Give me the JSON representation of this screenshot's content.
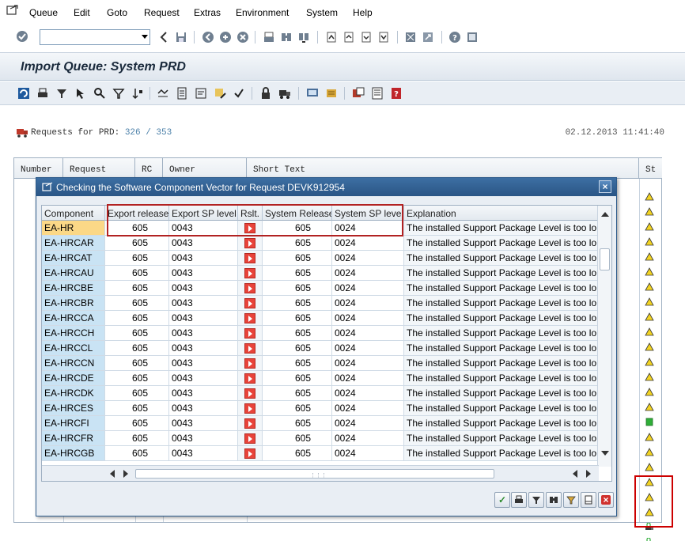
{
  "menubar": {
    "items": [
      {
        "label": "Queue"
      },
      {
        "label": "Edit"
      },
      {
        "label": "Goto"
      },
      {
        "label": "Request"
      },
      {
        "label": "Extras"
      },
      {
        "label": "Environment"
      },
      {
        "label": "System"
      },
      {
        "label": "Help"
      }
    ]
  },
  "system_toolbar": {
    "command_field_value": ""
  },
  "screen": {
    "title": "Import Queue: System PRD",
    "requests_label": "Requests for PRD:",
    "requests_count": "326 / 353",
    "date": "02.12.2013",
    "time": "11:41:40"
  },
  "background_table": {
    "columns": [
      "Number",
      "Request",
      "RC",
      "Owner",
      "Short Text",
      "St"
    ]
  },
  "dialog": {
    "title": "Checking the Software Component Vector for Request DEVK912954",
    "columns": [
      "Component",
      "Export release",
      "Export SP level",
      "Rslt.",
      "System Release",
      "System SP level",
      "Explanation"
    ],
    "rows": [
      {
        "component": "EA-HR",
        "export_release": "605",
        "export_sp": "0043",
        "system_release": "605",
        "system_sp": "0024",
        "explanation": "The installed Support Package Level is too lo"
      },
      {
        "component": "EA-HRCAR",
        "export_release": "605",
        "export_sp": "0043",
        "system_release": "605",
        "system_sp": "0024",
        "explanation": "The installed Support Package Level is too lo"
      },
      {
        "component": "EA-HRCAT",
        "export_release": "605",
        "export_sp": "0043",
        "system_release": "605",
        "system_sp": "0024",
        "explanation": "The installed Support Package Level is too lo"
      },
      {
        "component": "EA-HRCAU",
        "export_release": "605",
        "export_sp": "0043",
        "system_release": "605",
        "system_sp": "0024",
        "explanation": "The installed Support Package Level is too lo"
      },
      {
        "component": "EA-HRCBE",
        "export_release": "605",
        "export_sp": "0043",
        "system_release": "605",
        "system_sp": "0024",
        "explanation": "The installed Support Package Level is too lo"
      },
      {
        "component": "EA-HRCBR",
        "export_release": "605",
        "export_sp": "0043",
        "system_release": "605",
        "system_sp": "0024",
        "explanation": "The installed Support Package Level is too lo"
      },
      {
        "component": "EA-HRCCA",
        "export_release": "605",
        "export_sp": "0043",
        "system_release": "605",
        "system_sp": "0024",
        "explanation": "The installed Support Package Level is too lo"
      },
      {
        "component": "EA-HRCCH",
        "export_release": "605",
        "export_sp": "0043",
        "system_release": "605",
        "system_sp": "0024",
        "explanation": "The installed Support Package Level is too lo"
      },
      {
        "component": "EA-HRCCL",
        "export_release": "605",
        "export_sp": "0043",
        "system_release": "605",
        "system_sp": "0024",
        "explanation": "The installed Support Package Level is too lo"
      },
      {
        "component": "EA-HRCCN",
        "export_release": "605",
        "export_sp": "0043",
        "system_release": "605",
        "system_sp": "0024",
        "explanation": "The installed Support Package Level is too lo"
      },
      {
        "component": "EA-HRCDE",
        "export_release": "605",
        "export_sp": "0043",
        "system_release": "605",
        "system_sp": "0024",
        "explanation": "The installed Support Package Level is too lo"
      },
      {
        "component": "EA-HRCDK",
        "export_release": "605",
        "export_sp": "0043",
        "system_release": "605",
        "system_sp": "0024",
        "explanation": "The installed Support Package Level is too lo"
      },
      {
        "component": "EA-HRCES",
        "export_release": "605",
        "export_sp": "0043",
        "system_release": "605",
        "system_sp": "0024",
        "explanation": "The installed Support Package Level is too lo"
      },
      {
        "component": "EA-HRCFI",
        "export_release": "605",
        "export_sp": "0043",
        "system_release": "605",
        "system_sp": "0024",
        "explanation": "The installed Support Package Level is too lo"
      },
      {
        "component": "EA-HRCFR",
        "export_release": "605",
        "export_sp": "0043",
        "system_release": "605",
        "system_sp": "0024",
        "explanation": "The installed Support Package Level is too lo"
      },
      {
        "component": "EA-HRCGB",
        "export_release": "605",
        "export_sp": "0043",
        "system_release": "605",
        "system_sp": "0024",
        "explanation": "The installed Support Package Level is too lo"
      }
    ],
    "selected_row": 0
  },
  "status_icons": [
    "warning",
    "warning",
    "warning",
    "warning",
    "warning",
    "warning",
    "warning",
    "warning",
    "warning",
    "warning",
    "warning",
    "warning",
    "warning",
    "warning",
    "warning",
    "success",
    "warning",
    "warning",
    "warning",
    "warning",
    "warning",
    "warning",
    "lock-truck",
    "lock-truck",
    "lock-truck"
  ],
  "colors": {
    "dialog_title_bg": "#2a5585",
    "key_cell": "#c9e3f4",
    "selected_cell": "#fbd887",
    "result_error": "#e8433a",
    "highlight_box": "#b22222"
  }
}
